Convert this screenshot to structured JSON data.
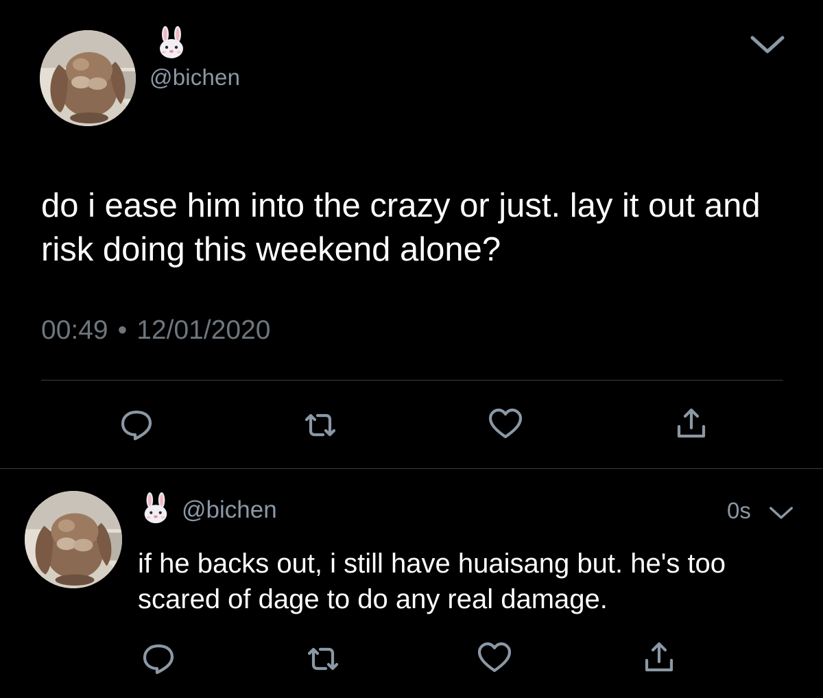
{
  "main_tweet": {
    "display_name_icon": "rabbit-face-emoji",
    "handle": "@bichen",
    "text": "do i ease him into the crazy or just. lay it out and risk doing this weekend alone?",
    "time": "00:49",
    "separator": "•",
    "date": "12/01/2020",
    "actions": [
      "reply-icon",
      "retweet-icon",
      "like-icon",
      "share-icon"
    ]
  },
  "reply_tweet": {
    "display_name_icon": "rabbit-face-emoji",
    "handle": "@bichen",
    "timestamp": "0s",
    "text": "if he backs out, i still have huaisang but. he's too scared of dage to do any real damage.",
    "actions": [
      "reply-icon",
      "retweet-icon",
      "like-icon",
      "share-icon"
    ]
  },
  "colors": {
    "background": "#000000",
    "text_primary": "#ffffff",
    "text_secondary": "#8b98a5",
    "meta": "#6e767d",
    "divider": "#3a3f44",
    "icon": "#8b98a5"
  }
}
